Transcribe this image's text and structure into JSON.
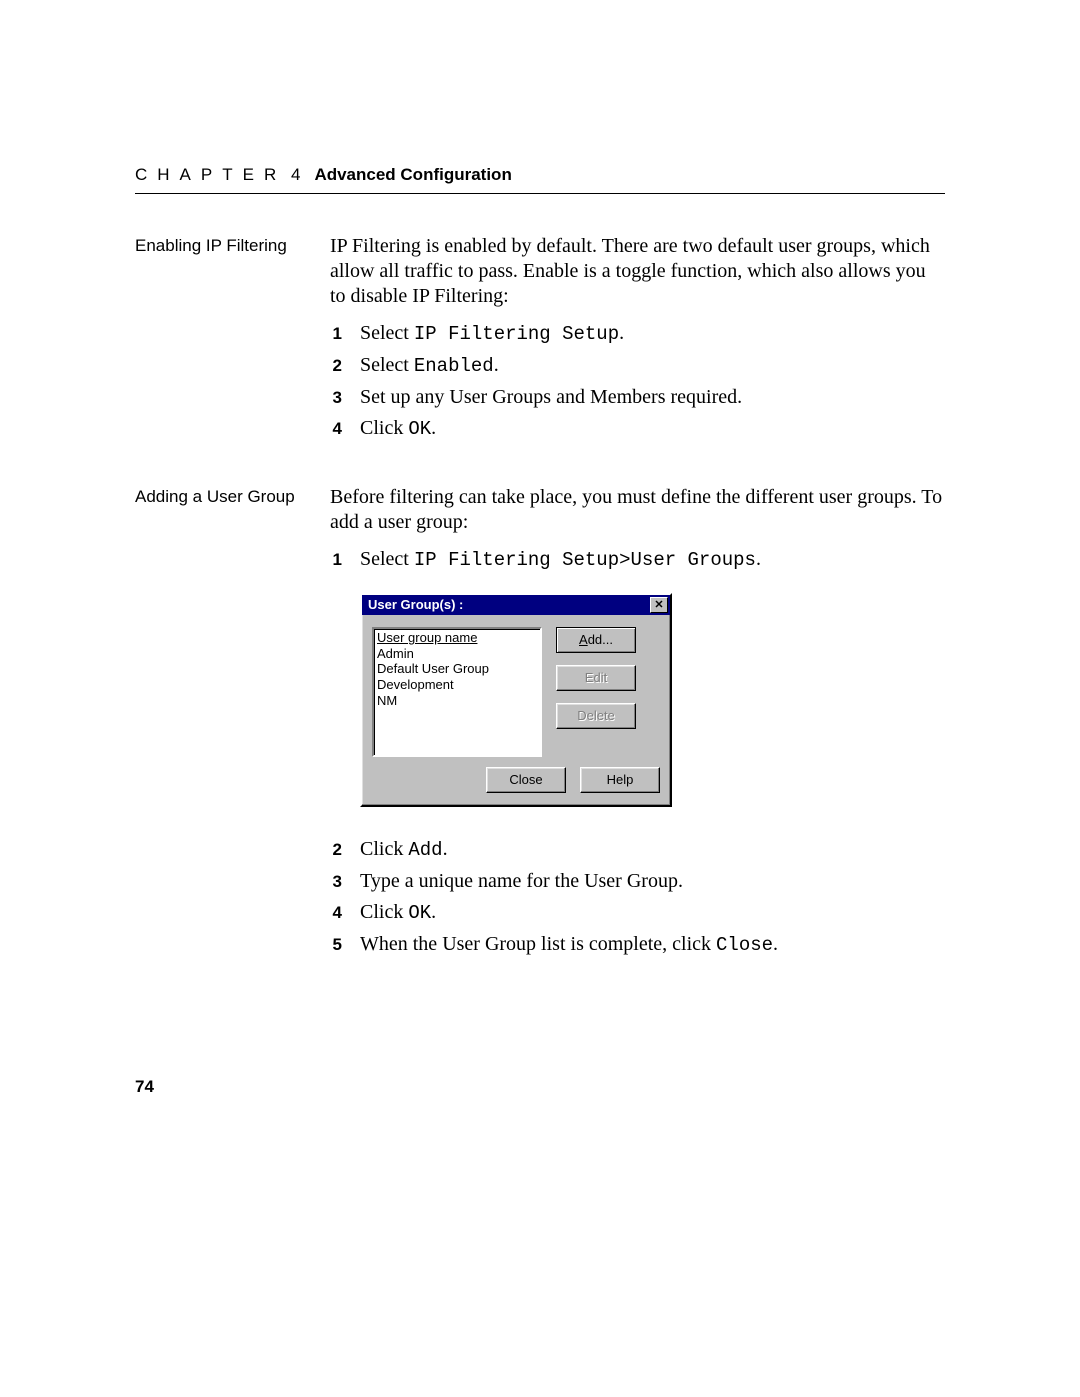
{
  "header": {
    "chapter_word": "CHAPTER",
    "chapter_number": "4",
    "chapter_title": "Advanced Configuration"
  },
  "section1": {
    "side_heading": "Enabling IP Filtering",
    "intro": "IP Filtering is enabled by default. There are two default user groups, which allow all traffic to pass. Enable is a toggle function, which also allows you to disable IP Filtering:",
    "steps": [
      {
        "n": "1",
        "pre": "Select ",
        "mono": "IP Filtering Setup",
        "post": "."
      },
      {
        "n": "2",
        "pre": "Select ",
        "mono": "Enabled",
        "post": "."
      },
      {
        "n": "3",
        "pre": "Set up any User Groups and Members required.",
        "mono": "",
        "post": ""
      },
      {
        "n": "4",
        "pre": "Click ",
        "mono": "OK",
        "post": "."
      }
    ]
  },
  "section2": {
    "side_heading": "Adding a User Group",
    "intro": "Before filtering can take place, you must define the different user groups. To add a user group:",
    "step1": {
      "n": "1",
      "pre": "Select ",
      "mono": "IP Filtering Setup>User Groups",
      "post": "."
    },
    "steps_after": [
      {
        "n": "2",
        "pre": "Click ",
        "mono": "Add",
        "post": "."
      },
      {
        "n": "3",
        "pre": "Type a unique name for the User Group.",
        "mono": "",
        "post": ""
      },
      {
        "n": "4",
        "pre": "Click ",
        "mono": "OK",
        "post": "."
      },
      {
        "n": "5",
        "pre": "When the User Group list is complete, click ",
        "mono": "Close",
        "post": "."
      }
    ]
  },
  "dialog": {
    "title": "User Group(s) :",
    "list_header": "User group name",
    "list_items": [
      "Admin",
      "Default User Group",
      "Development",
      "NM"
    ],
    "buttons": {
      "add_prefix": "A",
      "add_rest": "dd...",
      "edit": "Edit",
      "delete": "Delete",
      "close": "Close",
      "help": "Help"
    }
  },
  "page_number": "74"
}
